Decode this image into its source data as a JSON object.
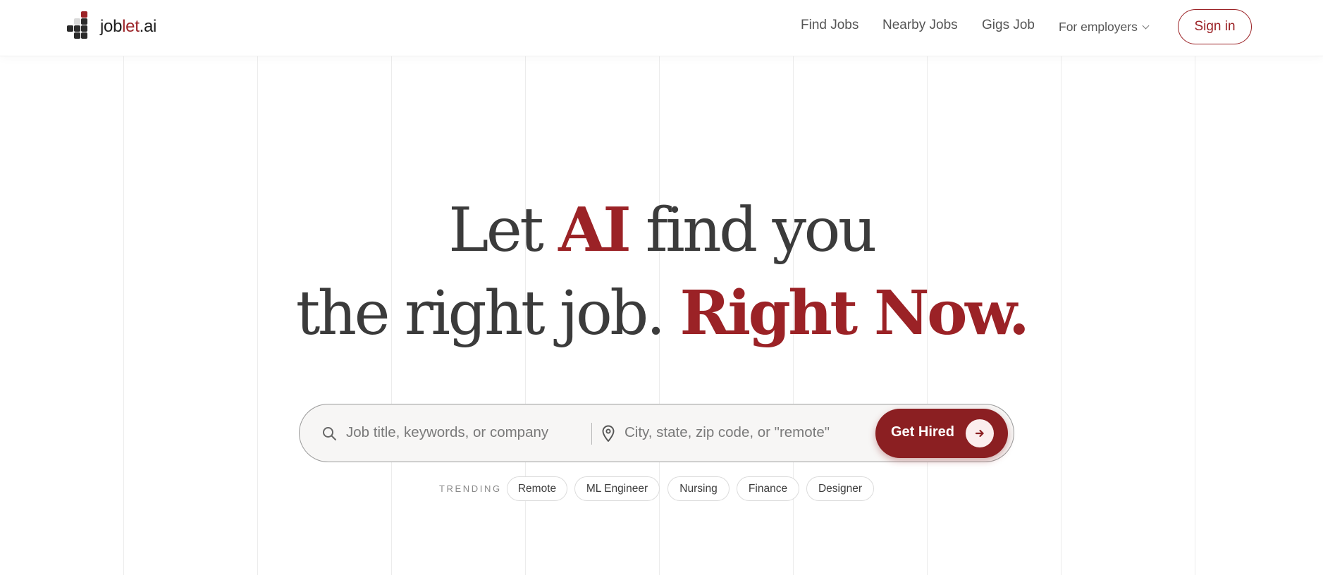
{
  "header": {
    "logo": {
      "text_main": "job",
      "text_accent": "let",
      "text_tail": ".ai"
    },
    "nav": {
      "find_jobs": "Find Jobs",
      "nearby_jobs": "Nearby Jobs",
      "gigs_job": "Gigs Job",
      "for_employers": "For employers"
    },
    "sign_in": "Sign in"
  },
  "hero": {
    "line1": {
      "a": "Let ",
      "b": "AI",
      "c": " find you"
    },
    "line2": {
      "a": "the right job. ",
      "b": "Right Now."
    }
  },
  "search": {
    "job_placeholder": "Job title, keywords, or company",
    "location_placeholder": "City, state, zip code, or \"remote\"",
    "submit_label": "Get Hired"
  },
  "trending": {
    "label": "TRENDING",
    "chips": [
      "Remote",
      "ML Engineer",
      "Nursing",
      "Finance",
      "Designer"
    ]
  },
  "colors": {
    "brand": "#9b2226",
    "button": "#8b1f22",
    "text": "#3b3b3b"
  },
  "icons": {
    "search": "search-icon",
    "location": "map-pin-icon",
    "submit": "arrow-right-icon",
    "dropdown": "chevron-down-icon"
  }
}
